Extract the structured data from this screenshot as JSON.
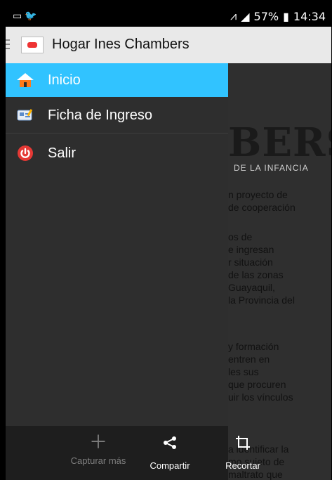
{
  "status_bar": {
    "left_icons": [
      "image-icon",
      "twitter-icon"
    ],
    "battery_percent": "57%",
    "time": "14:34"
  },
  "app_bar": {
    "title": "Hogar Ines Chambers"
  },
  "drawer": {
    "items": [
      {
        "label": "Inicio",
        "icon": "home-icon",
        "selected": true
      },
      {
        "label": "Ficha de Ingreso",
        "icon": "form-icon",
        "selected": false
      },
      {
        "label": "Salir",
        "icon": "power-icon",
        "selected": false
      }
    ]
  },
  "content": {
    "logo_text": "BERS",
    "logo_subtext": "DE LA INFANCIA",
    "paragraph_1": [
      "n proyecto de",
      "de cooperación"
    ],
    "paragraph_2": [
      "os de",
      "e ingresan",
      "r situación",
      "de las zonas",
      "Guayaquil,",
      "la Provincia del"
    ],
    "paragraph_3": [
      "y formación",
      "entren en",
      "les sus",
      "que procuren",
      "uir los vínculos"
    ],
    "paragraph_4": [
      "a identificar la",
      "mo sujeto de",
      "maltrato que"
    ]
  },
  "bottom_actions": [
    {
      "label": "Capturar más",
      "icon": "plus-icon",
      "enabled": false
    },
    {
      "label": "Compartir",
      "icon": "share-icon",
      "enabled": true
    },
    {
      "label": "Recortar",
      "icon": "crop-icon",
      "enabled": true
    }
  ],
  "colors": {
    "selected_item": "#31c3ff",
    "drawer_bg": "#2e2e2e",
    "appbar_bg": "#e9e9e9"
  }
}
